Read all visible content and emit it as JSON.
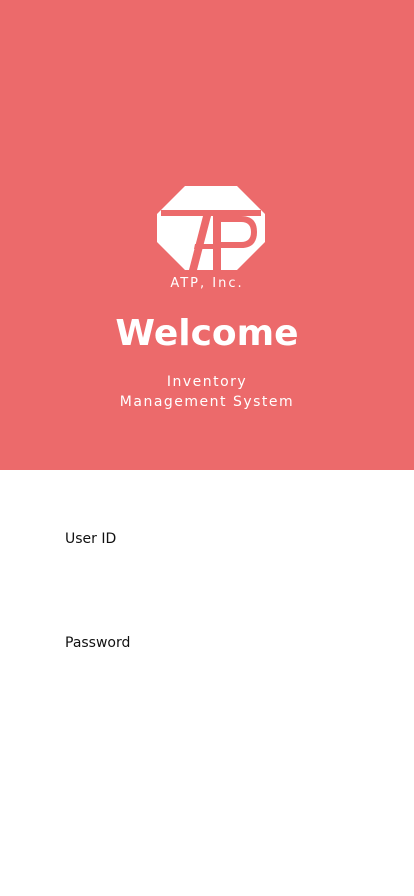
{
  "colors": {
    "hero_background": "#ec6a6b",
    "hero_text": "#ffffff",
    "page_background": "#ffffff",
    "label_text": "#111111"
  },
  "header": {
    "logo_icon": "atp-logo-icon",
    "company_name": "ATP, Inc.",
    "welcome_title": "Welcome",
    "subtitle_line1": "Inventory",
    "subtitle_line2": "Management System"
  },
  "form": {
    "user_id_label": "User ID",
    "user_id_value": "",
    "password_label": "Password",
    "password_value": ""
  }
}
